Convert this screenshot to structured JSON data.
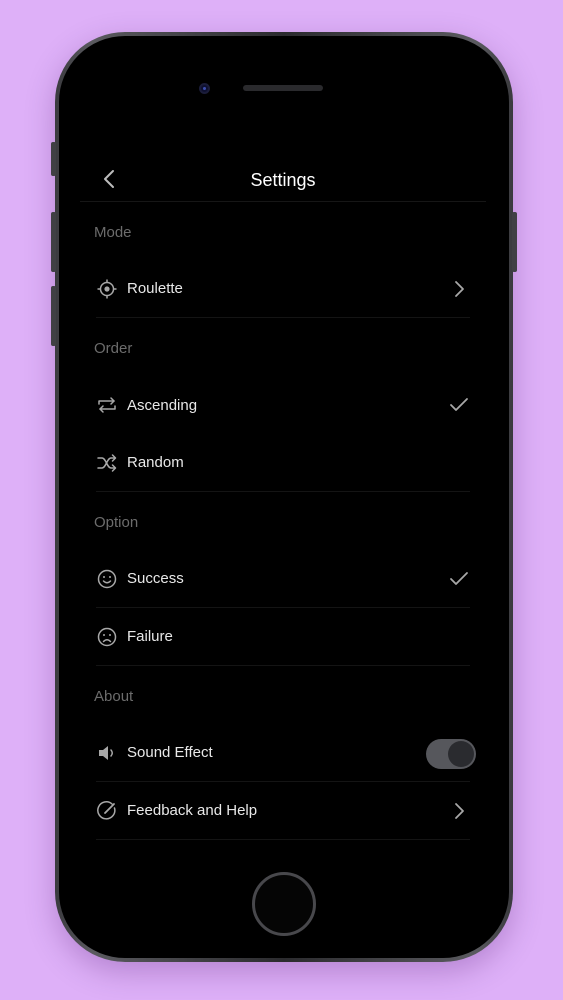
{
  "nav": {
    "title": "Settings",
    "back_icon": "chevron-left-icon"
  },
  "sections": {
    "mode": {
      "label": "Mode",
      "items": [
        {
          "label": "Roulette",
          "icon": "target-icon",
          "right": "chevron-right-icon"
        }
      ]
    },
    "order": {
      "label": "Order",
      "items": [
        {
          "label": "Ascending",
          "icon": "repeat-icon",
          "right": "checkmark-icon",
          "selected": true
        },
        {
          "label": "Random",
          "icon": "shuffle-icon",
          "right": "",
          "selected": false
        }
      ]
    },
    "option": {
      "label": "Option",
      "items": [
        {
          "label": "Success",
          "icon": "smile-icon",
          "right": "checkmark-icon",
          "selected": true
        },
        {
          "label": "Failure",
          "icon": "frown-icon",
          "right": "",
          "selected": false
        }
      ]
    },
    "about": {
      "label": "About",
      "items": [
        {
          "label": "Sound Effect",
          "icon": "speaker-icon",
          "right": "toggle",
          "toggle_on": true
        },
        {
          "label": "Feedback and Help",
          "icon": "edit-icon",
          "right": "chevron-right-icon"
        }
      ]
    }
  },
  "colors": {
    "background": "#deb0f8",
    "screen": "#000000",
    "section_label": "#6c6c6c",
    "item_text": "#e8e8e8",
    "icon": "#a8a8a8",
    "toggle_track": "#56575c"
  }
}
